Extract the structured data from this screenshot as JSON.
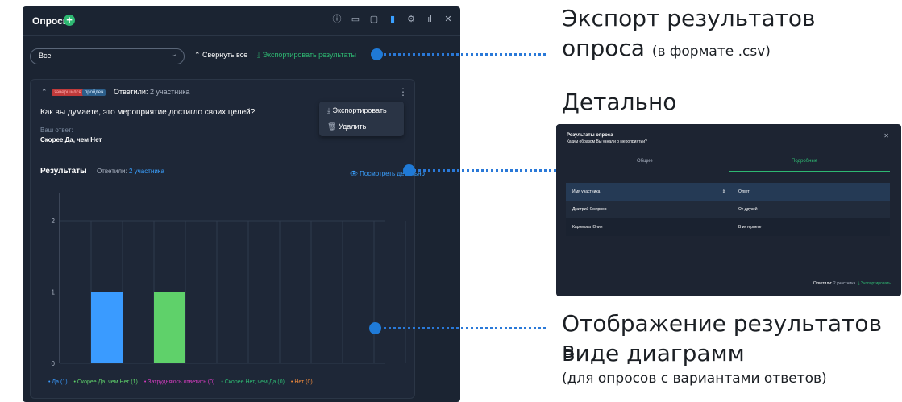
{
  "panel": {
    "title": "Опросы",
    "plus_label": "+",
    "filter": {
      "value": "Все"
    },
    "collapse_all": "⌃ Свернуть все",
    "export_results": "⤓ Экспортировать результаты",
    "card": {
      "badge_status1": "завершился",
      "badge_status2": "пройден",
      "answered": "Ответили:",
      "answered_count": "2 участника",
      "question": "Как вы думаете, это мероприятие достигло своих целей?",
      "your_answer_label": "Ваш ответ:",
      "your_answer": "Скорее Да, чем Нет",
      "menu": {
        "export": "Экспортировать",
        "delete": "Удалить"
      },
      "results_title": "Результаты",
      "results_answered": "Ответили:",
      "results_count": "2 участника",
      "view_details": "Посмотреть детально"
    }
  },
  "chart_data": {
    "type": "bar",
    "categories": [
      "Да",
      "Скорее Да, чем Нет",
      "Затрудняюсь ответить",
      "Скорее Нет, чем Да",
      "Нет"
    ],
    "values": [
      1,
      1,
      0,
      0,
      0
    ],
    "colors": [
      "#3a9bff",
      "#5fd16a",
      "#d63cc1",
      "#2eb872",
      "#f08a3c"
    ],
    "legend": [
      {
        "text": "• Да (1)",
        "color": "#3a9bff"
      },
      {
        "text": "• Скорее Да, чем Нет (1)",
        "color": "#5fd16a"
      },
      {
        "text": "• Затрудняюсь ответить (0)",
        "color": "#d63cc1"
      },
      {
        "text": "• Скорее Нет, чем Да (0)",
        "color": "#2eb872"
      },
      {
        "text": "• Нет (0)",
        "color": "#f08a3c"
      }
    ],
    "ylim": [
      0,
      2
    ],
    "yticks": [
      "0",
      "1",
      "2"
    ],
    "grid": true
  },
  "annotations": {
    "export_line1": "Экспорт результатов",
    "export_line2": "опроса",
    "export_suffix": "(в формате .csv)",
    "detail_title": "Детально",
    "charts_line1": "Отображение результатов в",
    "charts_line2": "виде диаграмм",
    "charts_sub": "(для опросов с вариантами ответов)"
  },
  "detail_panel": {
    "title": "Результаты опроса",
    "question": "Каким образом Вы узнали о мероприятии?",
    "tab_general": "Общие",
    "tab_detailed": "Подробные",
    "col_name": "Имя участника",
    "col_answer": "Ответ",
    "sort_icon": "⇕",
    "rows": [
      {
        "name": "Дмитрий Смирнов",
        "answer": "От друзей"
      },
      {
        "name": "Каримова Юлия",
        "answer": "В интернете"
      }
    ],
    "footer_answered": "Ответили:",
    "footer_count": "2 участника",
    "footer_export": "⤓ Экспортировать"
  },
  "icons": [
    "info-icon",
    "folder-icon",
    "screen-icon",
    "chat-icon",
    "settings-icon",
    "stats-icon",
    "close-icon",
    "chevron-down-icon",
    "download-icon",
    "trash-icon",
    "eye-icon",
    "kebab-icon"
  ]
}
